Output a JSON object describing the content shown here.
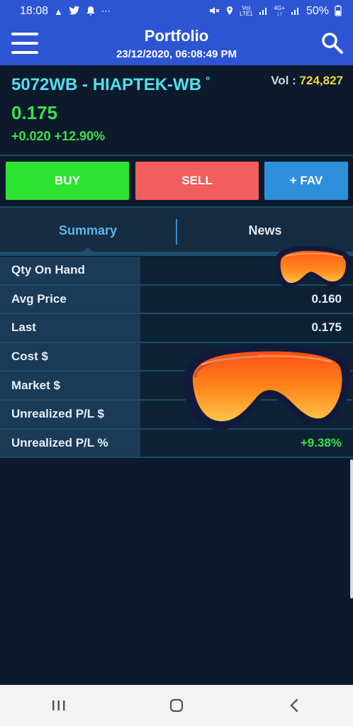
{
  "status_bar": {
    "time": "18:08",
    "battery": "50%",
    "left_icons": [
      "navigation-icon",
      "twitter-icon",
      "notification-icon",
      "more-dots-icon"
    ],
    "right_icons": [
      "mute-icon",
      "location-icon",
      "volte-icon",
      "signal-icon",
      "4g-icon",
      "signal-icon",
      "battery-icon"
    ]
  },
  "header": {
    "title": "Portfolio",
    "datetime": "23/12/2020, 06:08:49 PM"
  },
  "stock": {
    "name": "5072WB - HIAPTEK-WB",
    "dot": "°",
    "vol_label": "Vol :",
    "vol_value": "724,827",
    "price": "0.175",
    "change": "+0.020 +12.90%"
  },
  "actions": {
    "buy": "BUY",
    "sell": "SELL",
    "fav": "+ FAV"
  },
  "tabs": {
    "summary": "Summary",
    "news": "News"
  },
  "rows": [
    {
      "label": "Qty On Hand",
      "value": ""
    },
    {
      "label": "Avg Price",
      "value": "0.160"
    },
    {
      "label": "Last",
      "value": "0.175"
    },
    {
      "label": "Cost $",
      "value": ""
    },
    {
      "label": "Market $",
      "value": ""
    },
    {
      "label": "Unrealized P/L $",
      "value": ""
    },
    {
      "label": "Unrealized P/L %",
      "value": "+9.38%"
    }
  ],
  "colors": {
    "header_blue": "#2d55d3",
    "buy_green": "#2ee231",
    "sell_red": "#f25d5d",
    "fav_blue": "#2e8fdb",
    "positive_green": "#3de04a",
    "stock_cyan": "#4fe0f0",
    "vol_yellow": "#f2d53c"
  }
}
